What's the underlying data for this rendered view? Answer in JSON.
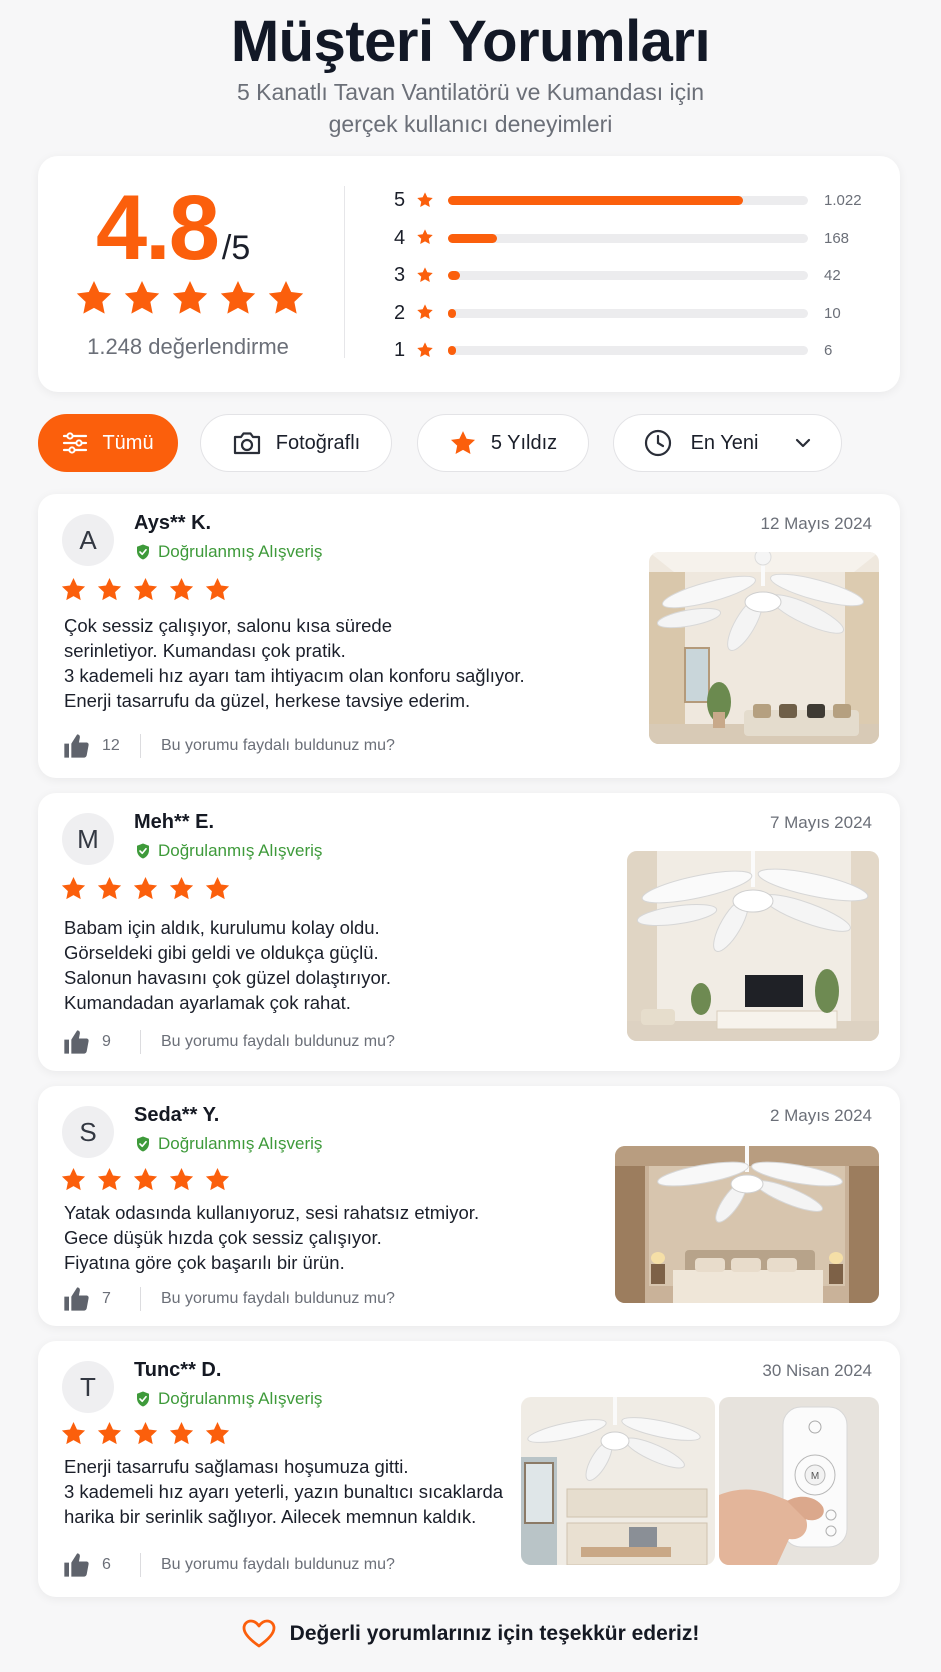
{
  "header": {
    "title": "Müşteri Yorumları",
    "subtitle_line1": "5 Kanatlı Tavan Vantilatörü ve Kumandası için",
    "subtitle_line2": "gerçek kullanıcı deneyimleri"
  },
  "summary": {
    "average": "4.8",
    "out_of": "/5",
    "stars": 5,
    "count_label": "1.248 değerlendirme",
    "distribution": [
      {
        "level": "5",
        "count": "1.022",
        "fraction": 0.819
      },
      {
        "level": "4",
        "count": "168",
        "fraction": 0.135
      },
      {
        "level": "3",
        "count": "42",
        "fraction": 0.034
      },
      {
        "level": "2",
        "count": "10",
        "fraction": 0.008
      },
      {
        "level": "1",
        "count": "6",
        "fraction": 0.005
      }
    ]
  },
  "filters": {
    "all": "Tümü",
    "photos": "Fotoğraflı",
    "five_star": "5 Yıldız",
    "sort": "En Yeni"
  },
  "reviews": [
    {
      "initial": "A",
      "name": "Ays** K.",
      "verified": "Doğrulanmış Alışveriş",
      "date": "12 Mayıs 2024",
      "rating": 5,
      "lines": [
        "Çok sessiz çalışıyor, salonu kısa sürede",
        "serinletiyor. Kumandası çok pratik.",
        "3 kademeli hız ayarı tam ihtiyacım olan konforu sağlıyor.",
        "Enerji tasarrufu da güzel, herkese tavsiye ederim."
      ],
      "helpful_count": "12",
      "helpful_text": "Bu yorumu faydalı buldunuz mu?"
    },
    {
      "initial": "M",
      "name": "Meh** E.",
      "verified": "Doğrulanmış Alışveriş",
      "date": "7 Mayıs 2024",
      "rating": 5,
      "lines": [
        "Babam için aldık, kurulumu kolay oldu.",
        "Görseldeki gibi geldi ve oldukça güçlü.",
        "Salonun havasını çok güzel dolaştırıyor.",
        "Kumandadan ayarlamak çok rahat."
      ],
      "helpful_count": "9",
      "helpful_text": "Bu yorumu faydalı buldunuz mu?"
    },
    {
      "initial": "S",
      "name": "Seda** Y.",
      "verified": "Doğrulanmış Alışveriş",
      "date": "2 Mayıs 2024",
      "rating": 5,
      "lines": [
        "Yatak odasında kullanıyoruz, sesi rahatsız etmiyor.",
        "Gece düşük hızda çok sessiz çalışıyor.",
        "Fiyatına göre çok başarılı bir ürün."
      ],
      "helpful_count": "7",
      "helpful_text": "Bu yorumu faydalı buldunuz mu?"
    },
    {
      "initial": "T",
      "name": "Tunc** D.",
      "verified": "Doğrulanmış Alışveriş",
      "date": "30 Nisan 2024",
      "rating": 5,
      "lines": [
        "Enerji tasarrufu sağlaması hoşumuza gitti.",
        "3 kademeli hız ayarı yeterli, yazın bunaltıcı sıcaklarda",
        "harika bir serinlik sağlıyor. Ailecek memnun kaldık."
      ],
      "helpful_count": "6",
      "helpful_text": "Bu yorumu faydalı buldunuz mu?"
    }
  ],
  "remote_labels": {
    "center": "M"
  },
  "footer": {
    "text": "Değerli yorumlarınız için teşekkür ederiz!"
  },
  "colors": {
    "accent": "#fb5f0c",
    "verified": "#3e9a3a",
    "text": "#1b1f2a",
    "muted": "#6b6f78"
  }
}
